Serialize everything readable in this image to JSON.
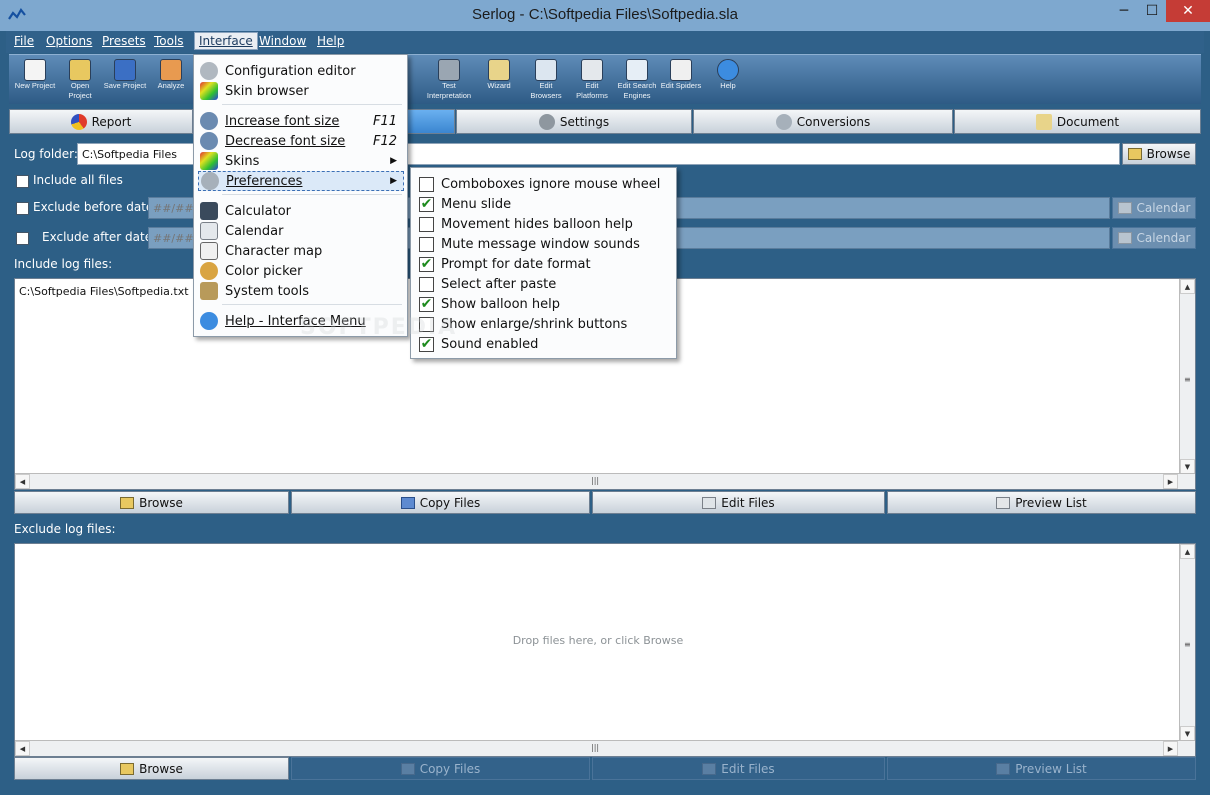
{
  "window": {
    "title": "Serlog - C:\\Softpedia Files\\Softpedia.sla",
    "minimize": "─",
    "maximize": "☐",
    "close": "✕"
  },
  "menubar": [
    "File",
    "Options",
    "Presets",
    "Tools",
    "Interface",
    "Window",
    "Help"
  ],
  "toolbar": [
    {
      "label": "New Project",
      "icon": "new-project-icon"
    },
    {
      "label": "Open Project",
      "icon": "open-project-icon"
    },
    {
      "label": "Save Project",
      "icon": "save-project-icon"
    },
    {
      "label": "Analyze",
      "icon": "analyze-icon"
    },
    {
      "label": "Test Interpretation",
      "icon": "test-interpretation-icon"
    },
    {
      "label": "Wizard",
      "icon": "wizard-icon"
    },
    {
      "label": "Edit Browsers",
      "icon": "edit-browsers-icon"
    },
    {
      "label": "Edit Platforms",
      "icon": "edit-platforms-icon"
    },
    {
      "label": "Edit Search Engines",
      "icon": "edit-search-engines-icon"
    },
    {
      "label": "Edit Spiders",
      "icon": "edit-spiders-icon"
    },
    {
      "label": "Help",
      "icon": "help-icon"
    }
  ],
  "tabs": [
    "Report",
    "",
    "Settings",
    "Conversions",
    "Document"
  ],
  "form": {
    "log_folder_label": "Log folder:",
    "log_folder_value": "C:\\Softpedia Files",
    "browse": "Browse",
    "include_all": "Include all files",
    "exclude_before": "Exclude before date",
    "exclude_after": "Exclude after date",
    "date_placeholder": "##/##/####",
    "calendar": "Calendar",
    "include_log_files": "Include log files:",
    "exclude_log_files": "Exclude log files:"
  },
  "include_list": [
    "C:\\Softpedia Files\\Softpedia.txt"
  ],
  "exclude_placeholder": "Drop files here, or click Browse",
  "list_buttons": {
    "browse": "Browse",
    "copy": "Copy Files",
    "edit": "Edit Files",
    "preview": "Preview List"
  },
  "interface_menu": [
    {
      "label": "Configuration editor",
      "icon": "configuration-editor-icon"
    },
    {
      "label": "Skin browser",
      "icon": "skin-browser-icon"
    },
    {
      "label": "Increase font size",
      "shortcut": "F11",
      "icon": "increase-font-icon"
    },
    {
      "label": "Decrease font size",
      "shortcut": "F12",
      "icon": "decrease-font-icon"
    },
    {
      "label": "Skins",
      "icon": "skins-icon"
    },
    {
      "label": "Preferences",
      "icon": "preferences-icon"
    },
    {
      "label": "Calculator",
      "icon": "calculator-icon"
    },
    {
      "label": "Calendar",
      "icon": "calendar-icon"
    },
    {
      "label": "Character map",
      "icon": "character-map-icon"
    },
    {
      "label": "Color picker",
      "icon": "color-picker-icon"
    },
    {
      "label": "System tools",
      "icon": "system-tools-icon"
    },
    {
      "label": "Help - Interface Menu",
      "icon": "help-icon"
    }
  ],
  "preferences_menu": [
    {
      "label": "Comboboxes ignore mouse wheel",
      "checked": false
    },
    {
      "label": "Menu slide",
      "checked": true
    },
    {
      "label": "Movement hides balloon help",
      "checked": false
    },
    {
      "label": "Mute message window sounds",
      "checked": false
    },
    {
      "label": "Prompt for date format",
      "checked": true
    },
    {
      "label": "Select after paste",
      "checked": false
    },
    {
      "label": "Show balloon help",
      "checked": true
    },
    {
      "label": "Show enlarge/shrink buttons",
      "checked": false
    },
    {
      "label": "Sound enabled",
      "checked": true
    }
  ],
  "check_glyph": "✔",
  "submenu_arrow": "▶",
  "watermark": "SOFTPEDIA"
}
